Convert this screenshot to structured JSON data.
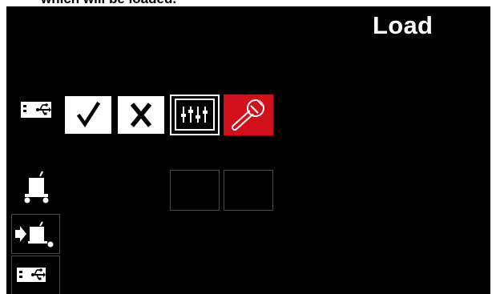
{
  "caption": {
    "text": "which will be loaded."
  },
  "screen": {
    "title": "Load"
  },
  "row1": {
    "source_icon": "usb-icon",
    "buttons": [
      {
        "name": "confirm-button",
        "icon": "checkmark-icon"
      },
      {
        "name": "cancel-button",
        "icon": "x-icon"
      },
      {
        "name": "settings-button",
        "icon": "sliders-icon"
      },
      {
        "name": "tools-button",
        "icon": "wrench-icon",
        "active": true
      }
    ]
  },
  "row2": {
    "source_icon": "cart-icon",
    "slots": [
      "empty",
      "empty"
    ]
  },
  "sidebar": {
    "items": [
      {
        "name": "load-from-machine-button",
        "icon": "arrow-cart-icon"
      },
      {
        "name": "load-from-usb-button",
        "icon": "usb-icon"
      }
    ]
  },
  "colors": {
    "background": "#000000",
    "accent": "#d1101c",
    "foreground": "#ffffff",
    "tile_border": "#4a4a4a"
  }
}
